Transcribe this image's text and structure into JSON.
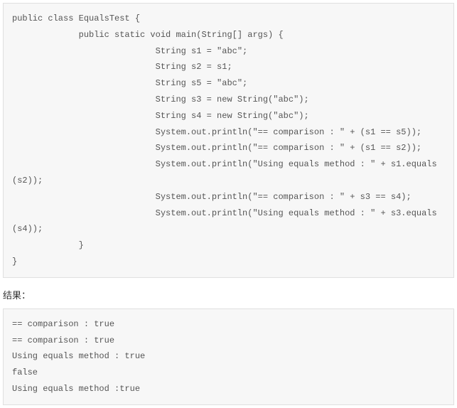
{
  "code": {
    "lines": [
      "public class EqualsTest {",
      "             public static void main(String[] args) {",
      "                            String s1 = \"abc\";",
      "                            String s2 = s1;",
      "                            String s5 = \"abc\";",
      "                            String s3 = new String(\"abc\");",
      "                            String s4 = new String(\"abc\");",
      "                            System.out.println(\"== comparison : \" + (s1 == s5));",
      "                            System.out.println(\"== comparison : \" + (s1 == s2));",
      "                            System.out.println(\"Using equals method : \" + s1.equals",
      "(s2));",
      "                            System.out.println(\"== comparison : \" + s3 == s4);",
      "                            System.out.println(\"Using equals method : \" + s3.equals",
      "(s4));",
      "             }",
      "}"
    ]
  },
  "result_label": "结果：",
  "output": {
    "lines": [
      "== comparison : true",
      "== comparison : true",
      "Using equals method : true",
      "false",
      "Using equals method :true"
    ]
  }
}
